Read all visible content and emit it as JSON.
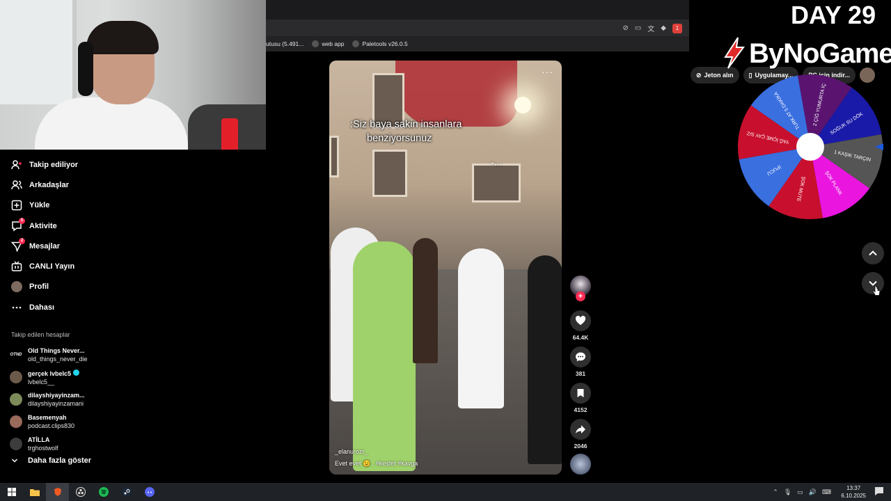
{
  "overlay": {
    "day_label": "DAY 29",
    "brand": "ByNoGame"
  },
  "browser": {
    "bookmarks": [
      {
        "label": "utusu (5.491..."
      },
      {
        "label": "web app"
      },
      {
        "label": "Paletools v26.0.5"
      }
    ],
    "extension_badge": "1"
  },
  "tiktok_header": {
    "coins_label": "Jeton alın",
    "app_label": "Uygulamay...",
    "pc_label": "PC için indir..."
  },
  "sidebar": {
    "items": [
      {
        "label": "Takip ediliyor",
        "icon": "following-icon",
        "badge": ""
      },
      {
        "label": "Arkadaşlar",
        "icon": "friends-icon",
        "badge": ""
      },
      {
        "label": "Yükle",
        "icon": "upload-icon",
        "badge": ""
      },
      {
        "label": "Aktivite",
        "icon": "activity-icon",
        "badge": "5"
      },
      {
        "label": "Mesajlar",
        "icon": "messages-icon",
        "badge": "2"
      },
      {
        "label": "CANLI Yayın",
        "icon": "live-icon",
        "badge": ""
      },
      {
        "label": "Profil",
        "icon": "profile-avatar",
        "badge": ""
      },
      {
        "label": "Dahası",
        "icon": "more-icon",
        "badge": ""
      }
    ],
    "followed_title": "Takip edilen hesaplar",
    "followed": [
      {
        "name": "Old Things Never...",
        "handle": "old_things_never_die",
        "avatar": "OTND",
        "verified": false
      },
      {
        "name": "gerçek lvbelc5",
        "handle": "lvbelc5__",
        "avatar": "",
        "verified": true
      },
      {
        "name": "dilayshiyayinzam...",
        "handle": "dilayshiyayinzamani",
        "avatar": "",
        "verified": false
      },
      {
        "name": "Basemenyah",
        "handle": "podcast.clips830",
        "avatar": "",
        "verified": false
      },
      {
        "name": "ATİLLA",
        "handle": "trghostwolf",
        "avatar": "",
        "verified": false
      }
    ],
    "show_more": "Daha fazla göster"
  },
  "video": {
    "caption_line1": ":Siz baya sakin insanlara",
    "caption_line2": "benziyorsunuz",
    "sign_text": "-...",
    "author": "_elanurozr_",
    "description": "Evet evet 😉 . #keşfet #kavga"
  },
  "actions": {
    "likes": "64.4K",
    "comments": "381",
    "saves": "4152",
    "shares": "2046"
  },
  "wheel": {
    "segments": [
      {
        "label": "2 ÇİĞ YUMURTA İÇ",
        "color": "#5a1470"
      },
      {
        "label": "SOĞUK SU DÖK",
        "color": "#1a1aa8"
      },
      {
        "label": "1 KAŞIK TARÇIN",
        "color": "#555555"
      },
      {
        "label": "ŞOK PLANK",
        "color": "#ea16e0"
      },
      {
        "label": "ŞOK MUTE",
        "color": "#c8102e"
      },
      {
        "label": "İPUCU",
        "color": "#3a6fe0"
      },
      {
        "label": "YAĞ İÇME ÇAY S/Z",
        "color": "#c8102e"
      },
      {
        "label": "TURK AT 5 DAKİKA",
        "color": "#3a6fe0"
      }
    ]
  },
  "taskbar": {
    "time": "13:37",
    "date": "6.10.2025"
  }
}
